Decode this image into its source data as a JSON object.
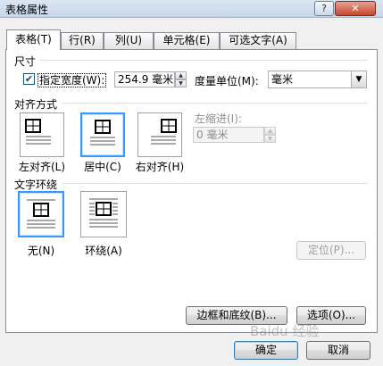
{
  "window": {
    "title": "表格属性",
    "help_glyph": "?",
    "close_glyph": "✕"
  },
  "tabs": [
    {
      "label": "表格(T)"
    },
    {
      "label": "行(R)"
    },
    {
      "label": "列(U)"
    },
    {
      "label": "单元格(E)"
    },
    {
      "label": "可选文字(A)"
    }
  ],
  "size_section": {
    "title": "尺寸",
    "checkbox_checked_glyph": "✔",
    "preferred_width_label": "指定宽度(W):",
    "preferred_width_value": "254.9 毫米",
    "measure_in_label": "度量单位(M):",
    "measure_in_value": "毫米"
  },
  "alignment_section": {
    "title": "对齐方式",
    "options": [
      {
        "label": "左对齐(L)",
        "icon": "align-left-icon"
      },
      {
        "label": "居中(C)",
        "icon": "align-center-icon",
        "selected": true
      },
      {
        "label": "右对齐(H)",
        "icon": "align-right-icon"
      }
    ],
    "indent_label": "左缩进(I):",
    "indent_value": "0 毫米"
  },
  "wrap_section": {
    "title": "文字环绕",
    "options": [
      {
        "label": "无(N)",
        "icon": "wrap-none-icon",
        "selected": true
      },
      {
        "label": "环绕(A)",
        "icon": "wrap-around-icon"
      }
    ],
    "positioning_button": "定位(P)..."
  },
  "buttons": {
    "borders_shading": "边框和底纹(B)...",
    "options": "选项(O)...",
    "ok": "确定",
    "cancel": "取消"
  },
  "watermark": "Baidu 经验"
}
